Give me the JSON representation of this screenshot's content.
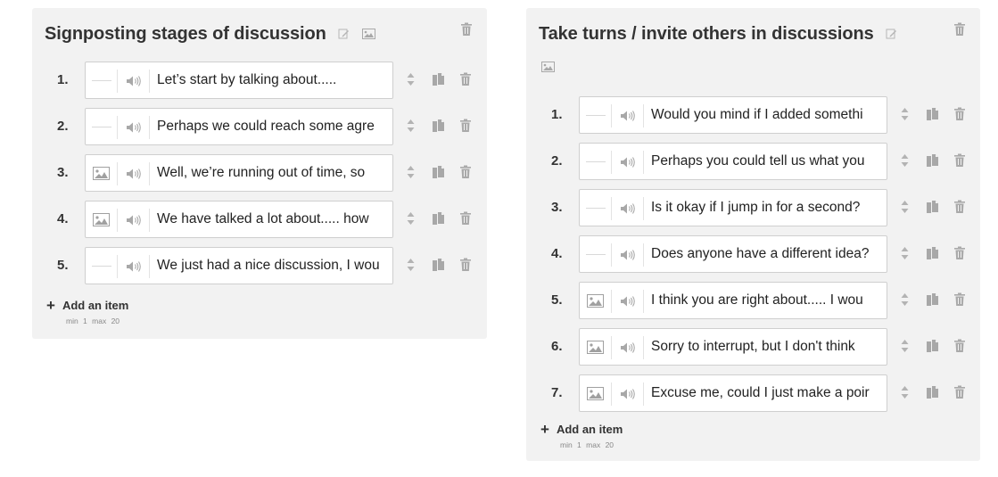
{
  "colors": {
    "panel_bg": "#f2f2f2",
    "icon_gray": "#b0b0b0",
    "text": "#333333"
  },
  "left": {
    "title": "Signposting stages of discussion",
    "items": [
      {
        "num": "1.",
        "media": "empty",
        "text": "Let’s start by talking about....."
      },
      {
        "num": "2.",
        "media": "empty",
        "text": "Perhaps we could reach some agre"
      },
      {
        "num": "3.",
        "media": "image",
        "text": "Well, we’re running out of time, so"
      },
      {
        "num": "4.",
        "media": "image",
        "text": "We have talked a lot about..... how"
      },
      {
        "num": "5.",
        "media": "empty",
        "text": "We just had a nice discussion, I wou"
      }
    ],
    "add_label": "Add an item",
    "minmax": "min 1 max 20"
  },
  "right": {
    "title": "Take turns / invite others in discussions",
    "items": [
      {
        "num": "1.",
        "media": "empty",
        "text": "Would you mind if I added somethi"
      },
      {
        "num": "2.",
        "media": "empty",
        "text": "Perhaps you could tell us what you"
      },
      {
        "num": "3.",
        "media": "empty",
        "text": "Is it okay if I jump in for a second?"
      },
      {
        "num": "4.",
        "media": "empty",
        "text": "Does anyone have a different idea?"
      },
      {
        "num": "5.",
        "media": "image",
        "text": "I think you are right about..... I wou"
      },
      {
        "num": "6.",
        "media": "image",
        "text": "Sorry to interrupt, but I don't think"
      },
      {
        "num": "7.",
        "media": "image",
        "text": "Excuse me, could I just make a poir"
      }
    ],
    "add_label": "Add an item",
    "minmax": "min 1 max 20"
  },
  "icons": {
    "edit": "pencil-edit-icon",
    "image": "image-icon",
    "trash": "trash-icon",
    "sort": "sort-arrows-icon",
    "copy": "duplicate-icon",
    "audio": "speaker-icon",
    "add": "plus-icon"
  }
}
